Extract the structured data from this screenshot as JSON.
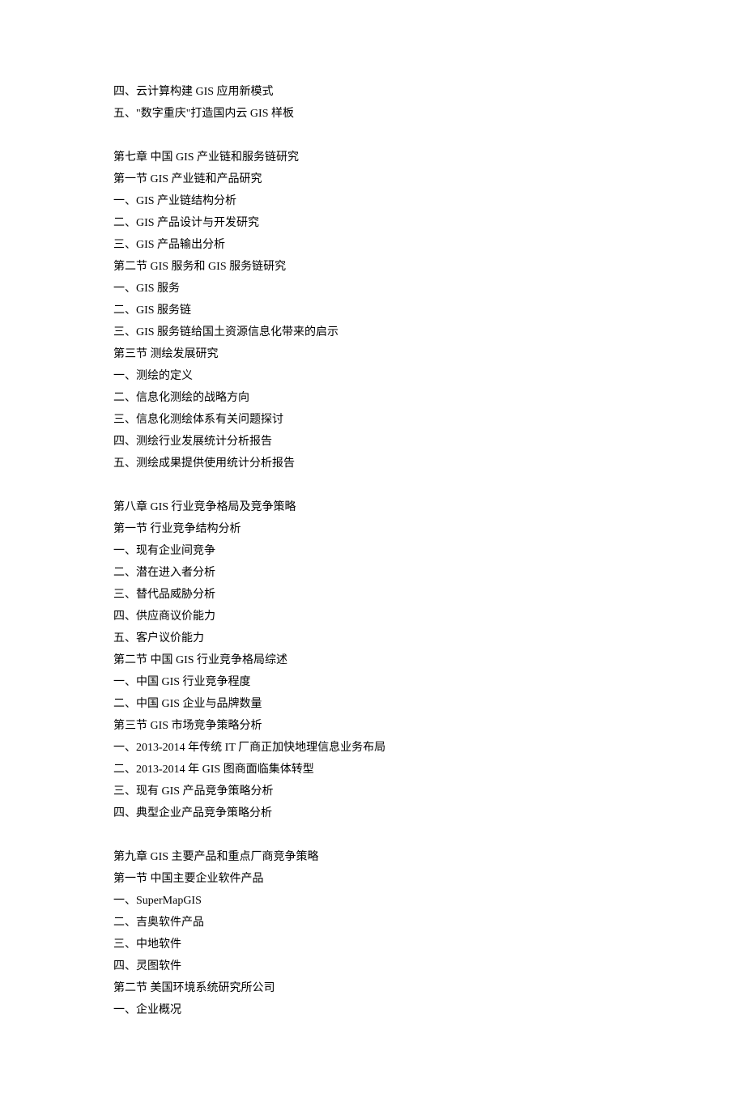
{
  "lines": [
    "四、云计算构建 GIS 应用新模式",
    "五、\"数字重庆\"打造国内云 GIS 样板",
    "",
    "第七章 中国 GIS 产业链和服务链研究",
    "第一节 GIS 产业链和产品研究",
    "一、GIS 产业链结构分析",
    "二、GIS 产品设计与开发研究",
    "三、GIS 产品输出分析",
    "第二节 GIS 服务和 GIS 服务链研究",
    "一、GIS 服务",
    "二、GIS 服务链",
    "三、GIS 服务链给国土资源信息化带来的启示",
    "第三节 测绘发展研究",
    "一、测绘的定义",
    "二、信息化测绘的战略方向",
    "三、信息化测绘体系有关问题探讨",
    "四、测绘行业发展统计分析报告",
    "五、测绘成果提供使用统计分析报告",
    "",
    "第八章 GIS 行业竞争格局及竞争策略",
    "第一节 行业竞争结构分析",
    "一、现有企业间竞争",
    "二、潜在进入者分析",
    "三、替代品威胁分析",
    "四、供应商议价能力",
    "五、客户议价能力",
    "第二节 中国 GIS 行业竞争格局综述",
    "一、中国 GIS 行业竞争程度",
    "二、中国 GIS 企业与品牌数量",
    "第三节 GIS 市场竞争策略分析",
    "一、2013-2014 年传统 IT 厂商正加快地理信息业务布局",
    "二、2013-2014 年 GIS 图商面临集体转型",
    "三、现有 GIS 产品竞争策略分析",
    "四、典型企业产品竞争策略分析",
    "",
    "第九章 GIS 主要产品和重点厂商竞争策略",
    "第一节 中国主要企业软件产品",
    "一、SuperMapGIS",
    "二、吉奥软件产品",
    "三、中地软件",
    "四、灵图软件",
    "第二节 美国环境系统研究所公司",
    "一、企业概况"
  ]
}
